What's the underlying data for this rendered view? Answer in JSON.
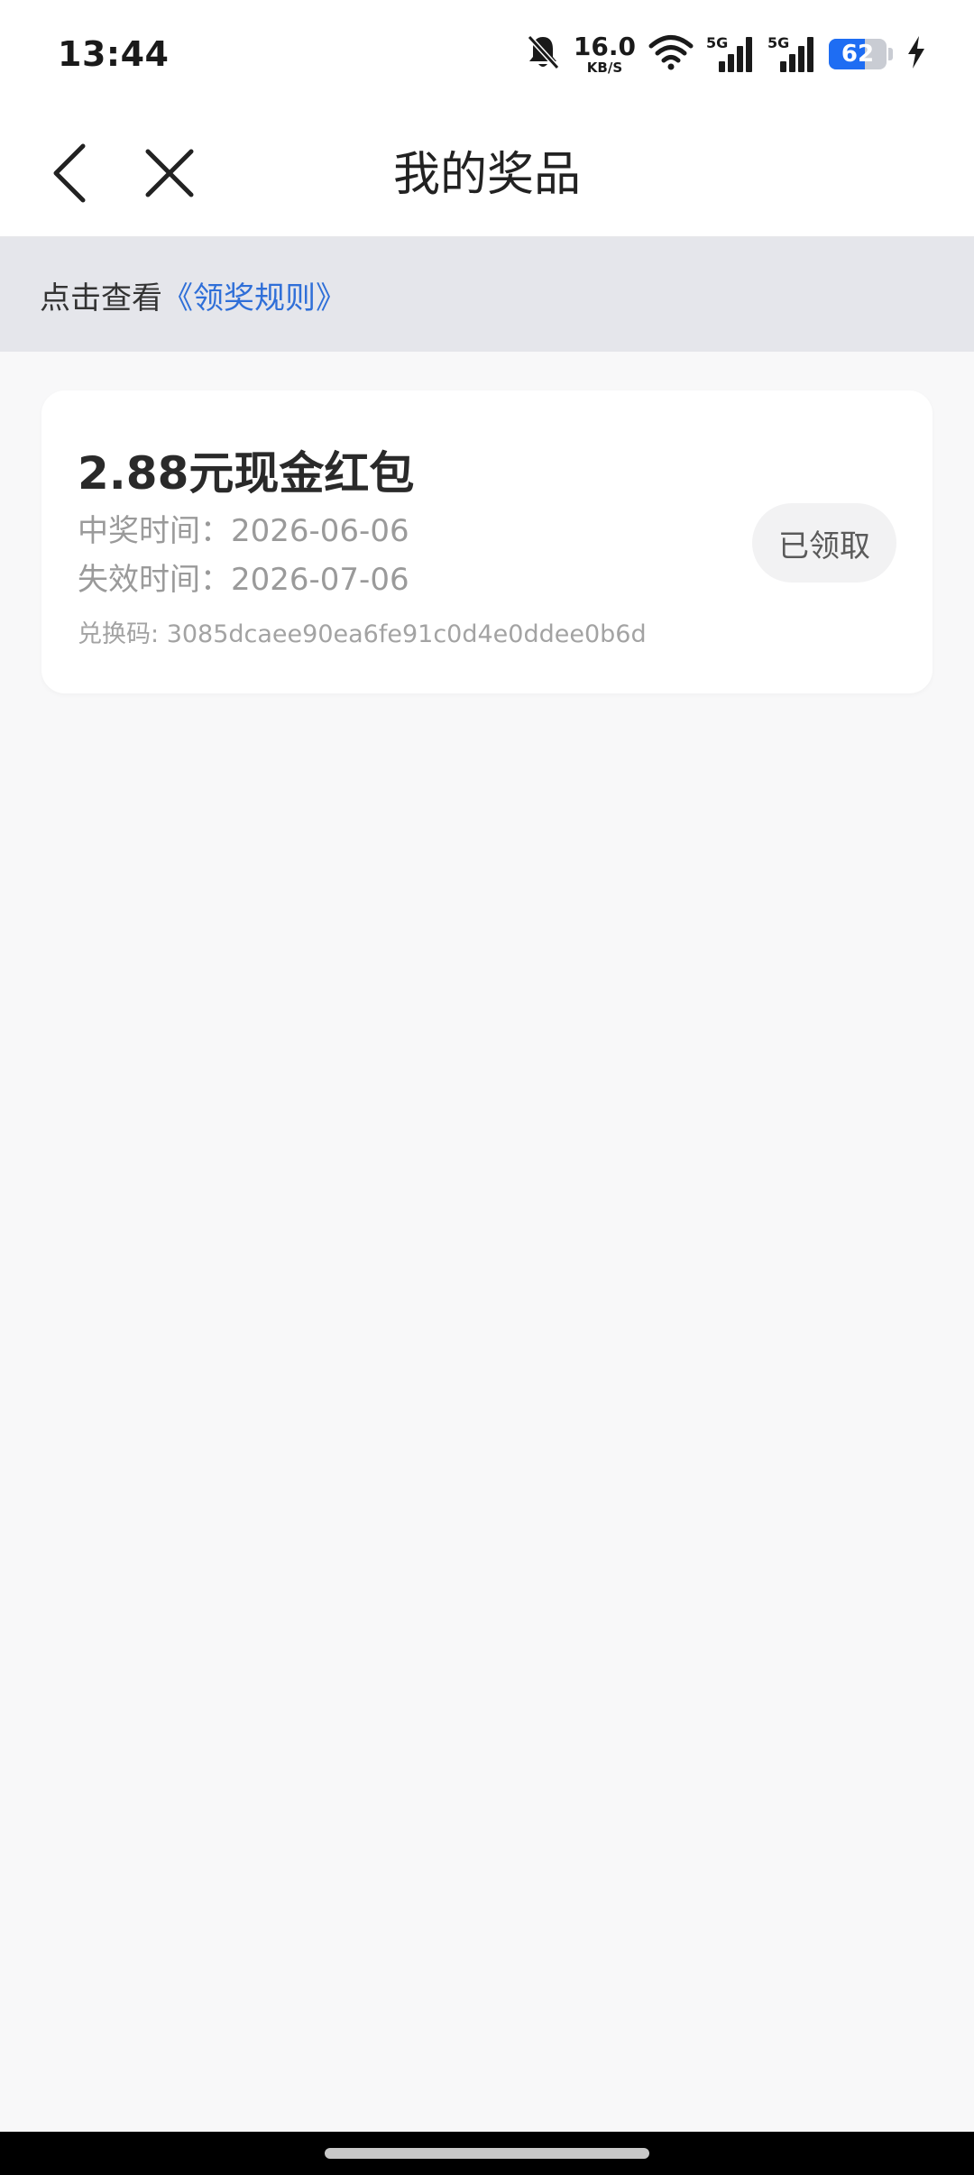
{
  "status_bar": {
    "time": "13:44",
    "net_speed_value": "16.0",
    "net_speed_unit": "KB/S",
    "sim1_tag": "5G",
    "sim2_tag": "5G",
    "battery_level": "62",
    "battery_fraction": 0.62,
    "icons": [
      "bell-off-icon",
      "wifi-icon",
      "signal-icon",
      "signal-icon",
      "battery-icon",
      "charging-bolt-icon"
    ]
  },
  "nav": {
    "title": "我的奖品",
    "back_icon": "chevron-left-icon",
    "close_icon": "close-icon"
  },
  "rules_banner": {
    "prefix": "点击查看",
    "link": "《领奖规则》"
  },
  "prizes": [
    {
      "name": "2.88元现金红包",
      "won_label": "中奖时间：",
      "won_date": "2026-06-06",
      "expire_label": "失效时间：",
      "expire_date": "2026-07-06",
      "code_label": "兑换码: ",
      "code": "3085dcaee90ea6fe91c0d4e0ddee0b6d",
      "status": "已领取"
    }
  ],
  "colors": {
    "accent_link": "#2f6fd8",
    "battery_fill": "#1e6df3",
    "page_bg": "#f8f8f9",
    "banner_bg": "#e5e6eb"
  }
}
